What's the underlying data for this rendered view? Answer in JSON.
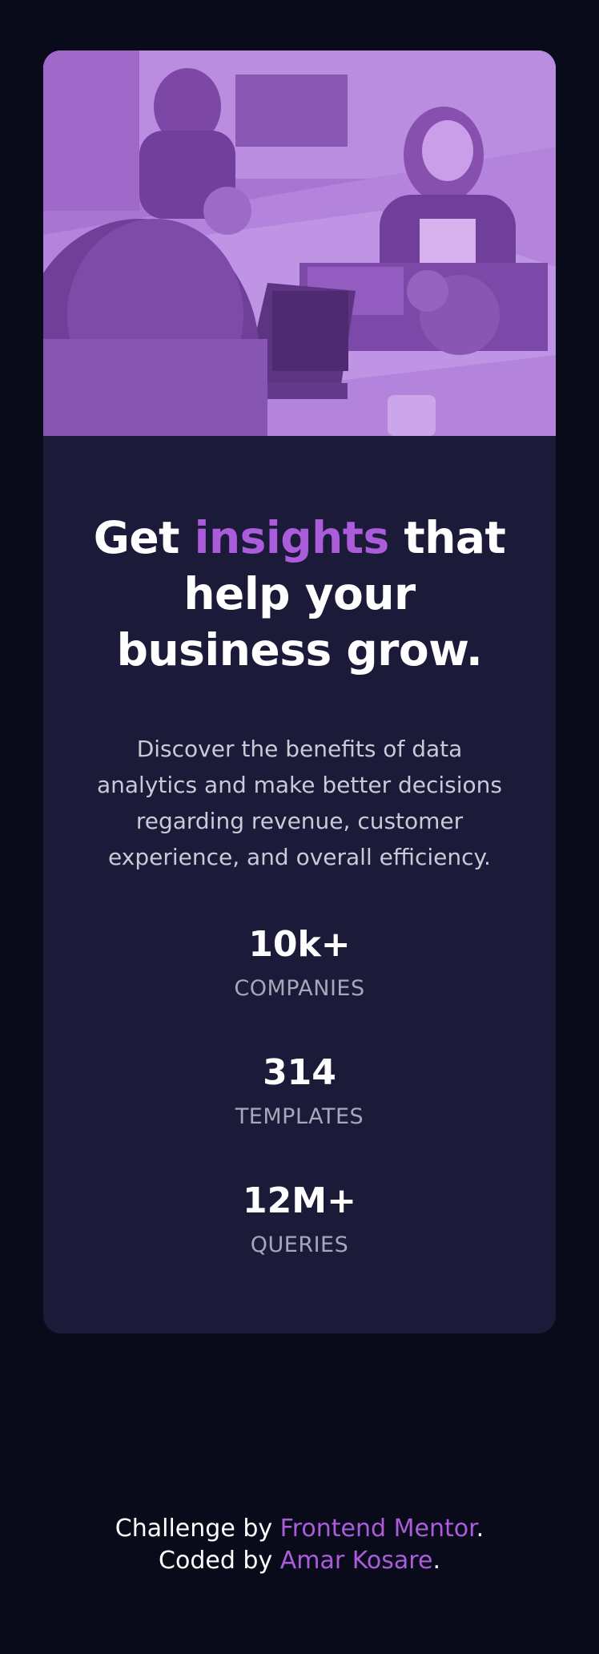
{
  "hero": {
    "image": "team-at-table-photo-purple-overlay"
  },
  "headline": {
    "before": "Get",
    "accent": "insights",
    "after": "that help your business grow."
  },
  "description": "Discover the benefits of data analytics and make better decisions regarding revenue, customer experience, and overall efficiency.",
  "stats": [
    {
      "value": "10k+",
      "label": "COMPANIES"
    },
    {
      "value": "314",
      "label": "TEMPLATES"
    },
    {
      "value": "12M+",
      "label": "QUERIES"
    }
  ],
  "footer": {
    "line1_prefix": "Challenge by",
    "line1_link": "Frontend Mentor",
    "line1_suffix": ".",
    "line2_prefix": "Coded by",
    "line2_link": "Amar Kosare",
    "line2_suffix": "."
  },
  "colors": {
    "page_bg": "#090b1a",
    "card_bg": "#1c1a39",
    "accent": "#ab5cdb",
    "text_main": "#ffffff",
    "text_muted": "#a8a6b8"
  }
}
